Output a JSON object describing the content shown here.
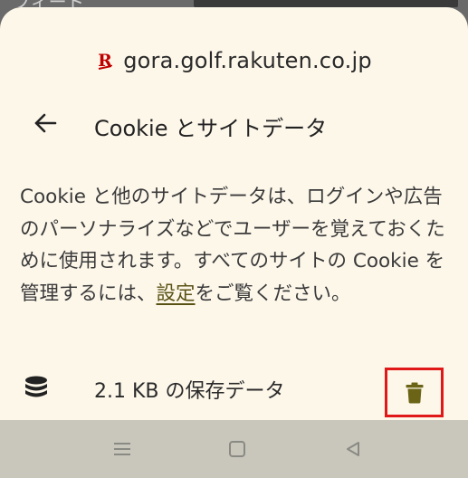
{
  "background": {
    "partial_text": "フィード"
  },
  "site": {
    "domain": "gora.golf.rakuten.co.jp",
    "favicon_icon": "rakuten-r-icon",
    "favicon_letter": "R",
    "favicon_color": "#bf0000"
  },
  "header": {
    "back_icon": "arrow-left-icon",
    "title": "Cookie とサイトデータ"
  },
  "description": {
    "text_before_link": "Cookie と他のサイトデータは、ログインや広告のパーソナライズなどでユーザーを覚えておくために使用されます。すべてのサイトの Cookie を管理するには、",
    "link_label": "設定",
    "text_after_link": "をご覧ください。"
  },
  "storage": {
    "icon": "database-icon",
    "label": "2.1 KB の保存データ",
    "delete_icon": "trash-icon",
    "delete_icon_color": "#6b6416",
    "highlight_color": "#e01818"
  },
  "navbar": {
    "menu_icon": "recents-menu-icon",
    "home_icon": "home-square-icon",
    "back_icon": "back-triangle-icon"
  },
  "colors": {
    "sheet": "#fdf7ea",
    "navbar": "#c9c7bc",
    "link": "#5a5214"
  }
}
